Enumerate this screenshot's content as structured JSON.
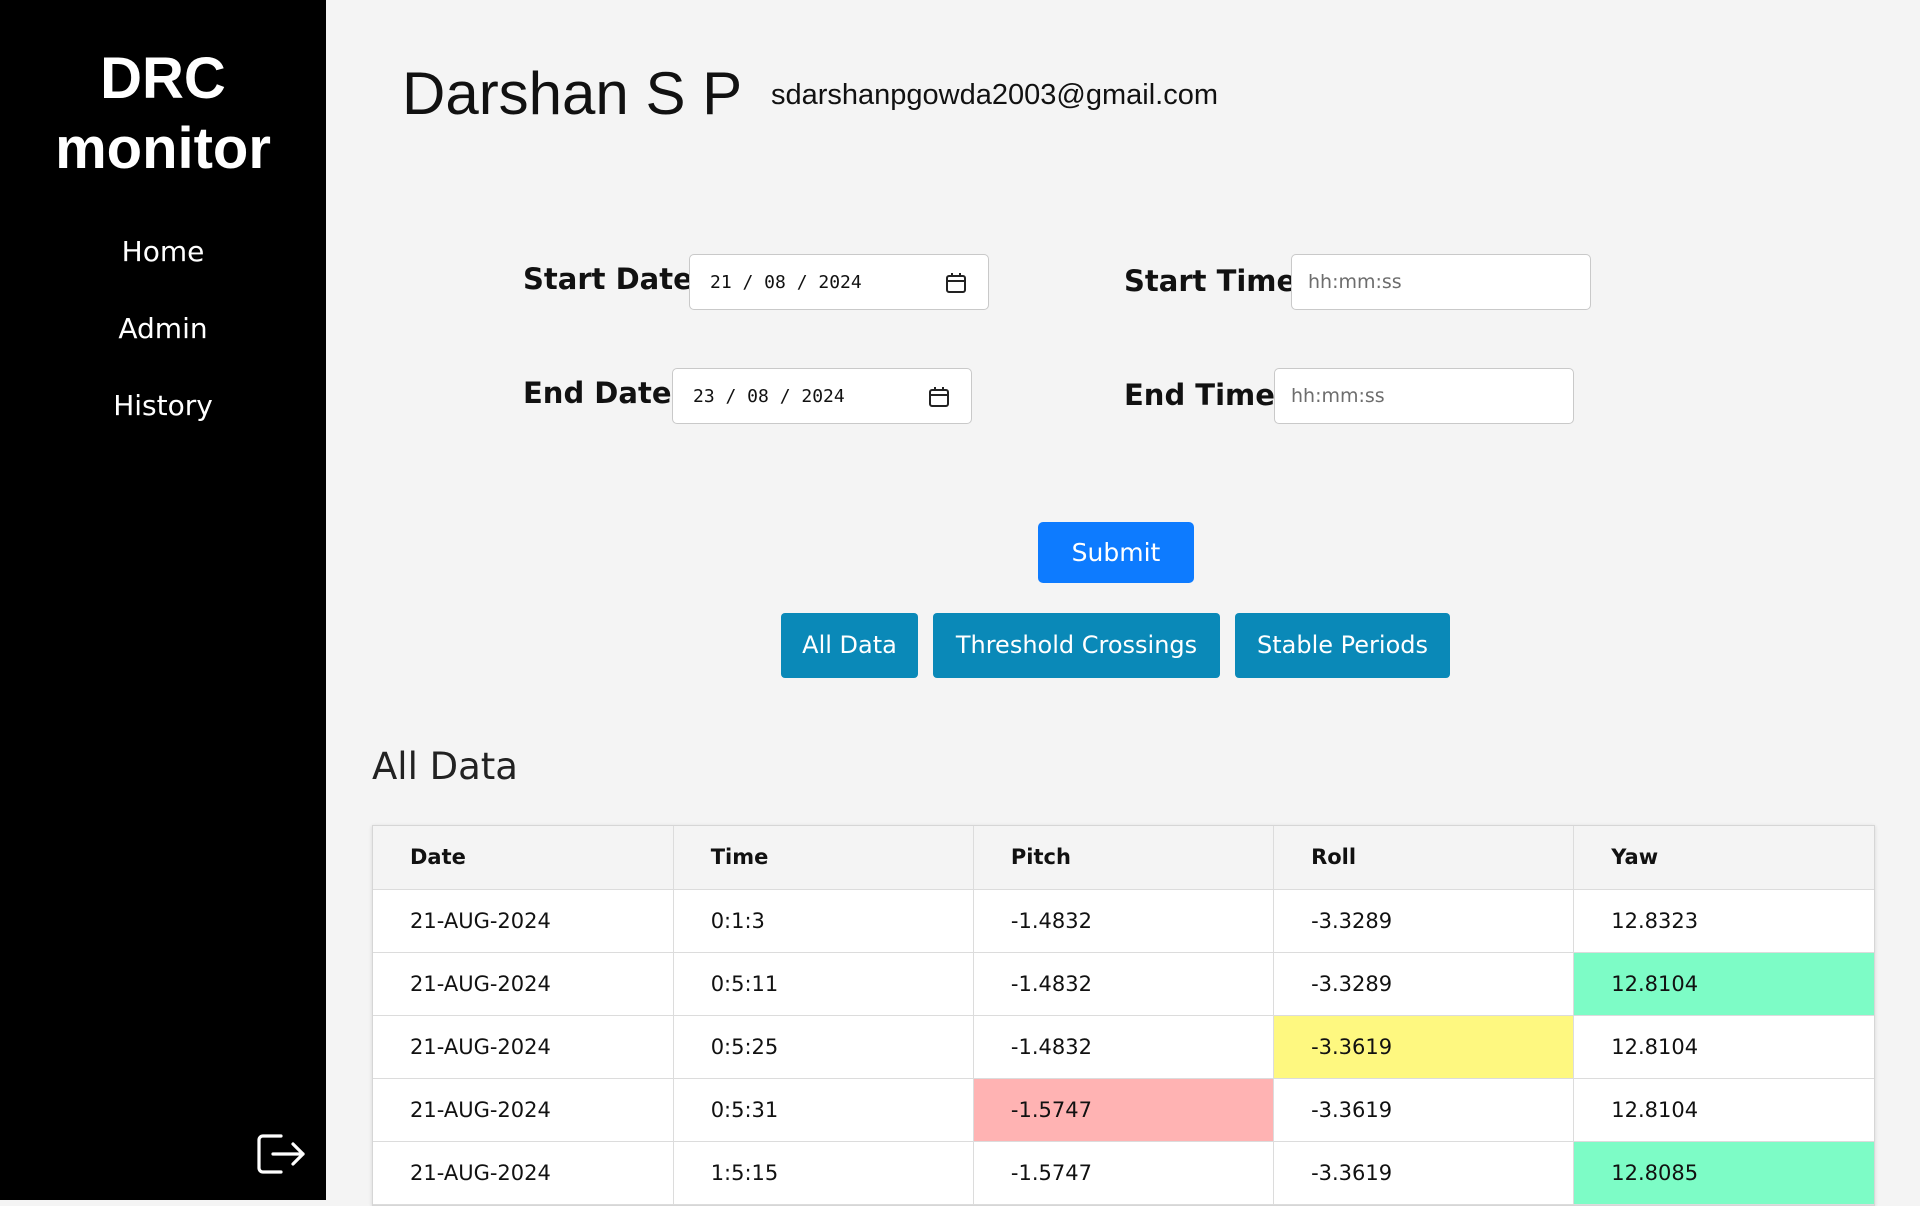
{
  "sidebar": {
    "brand_line1": "DRC",
    "brand_line2": "monitor",
    "items": [
      {
        "label": "Home"
      },
      {
        "label": "Admin"
      },
      {
        "label": "History"
      }
    ],
    "logout_icon": "logout-icon"
  },
  "header": {
    "user_name": "Darshan S P",
    "user_email": "sdarshanpgowda2003@gmail.com"
  },
  "form": {
    "start_date_label": "Start Date",
    "start_date_value": "21 / 08 / 2024",
    "end_date_label": "End Date",
    "end_date_value": "23 / 08 / 2024",
    "start_time_label": "Start Time",
    "start_time_placeholder": "hh:mm:ss",
    "end_time_label": "End Time",
    "end_time_placeholder": "hh:mm:ss",
    "calendar_icon": "calendar-icon",
    "submit_label": "Submit"
  },
  "filters": {
    "all_data": "All Data",
    "threshold_crossings": "Threshold Crossings",
    "stable_periods": "Stable Periods"
  },
  "table": {
    "title": "All Data",
    "columns": [
      "Date",
      "Time",
      "Pitch",
      "Roll",
      "Yaw"
    ],
    "rows": [
      {
        "cells": [
          "21-AUG-2024",
          "0:1:3",
          "-1.4832",
          "-3.3289",
          "12.8323"
        ],
        "highlights": [
          "",
          "",
          "",
          "",
          ""
        ]
      },
      {
        "cells": [
          "21-AUG-2024",
          "0:5:11",
          "-1.4832",
          "-3.3289",
          "12.8104"
        ],
        "highlights": [
          "",
          "",
          "",
          "",
          "green"
        ]
      },
      {
        "cells": [
          "21-AUG-2024",
          "0:5:25",
          "-1.4832",
          "-3.3619",
          "12.8104"
        ],
        "highlights": [
          "",
          "",
          "",
          "yellow",
          ""
        ]
      },
      {
        "cells": [
          "21-AUG-2024",
          "0:5:31",
          "-1.5747",
          "-3.3619",
          "12.8104"
        ],
        "highlights": [
          "",
          "",
          "red",
          "",
          ""
        ]
      },
      {
        "cells": [
          "21-AUG-2024",
          "1:5:15",
          "-1.5747",
          "-3.3619",
          "12.8085"
        ],
        "highlights": [
          "",
          "",
          "",
          "",
          "green"
        ]
      }
    ],
    "highlight_colors": {
      "green": "#7dfcc6",
      "yellow": "#fef880",
      "red": "#ffb3b3"
    }
  },
  "colors": {
    "sidebar_bg": "#000000",
    "page_bg": "#f4f4f4",
    "submit_bg": "#0d7bff",
    "filter_bg": "#0a89b8"
  }
}
